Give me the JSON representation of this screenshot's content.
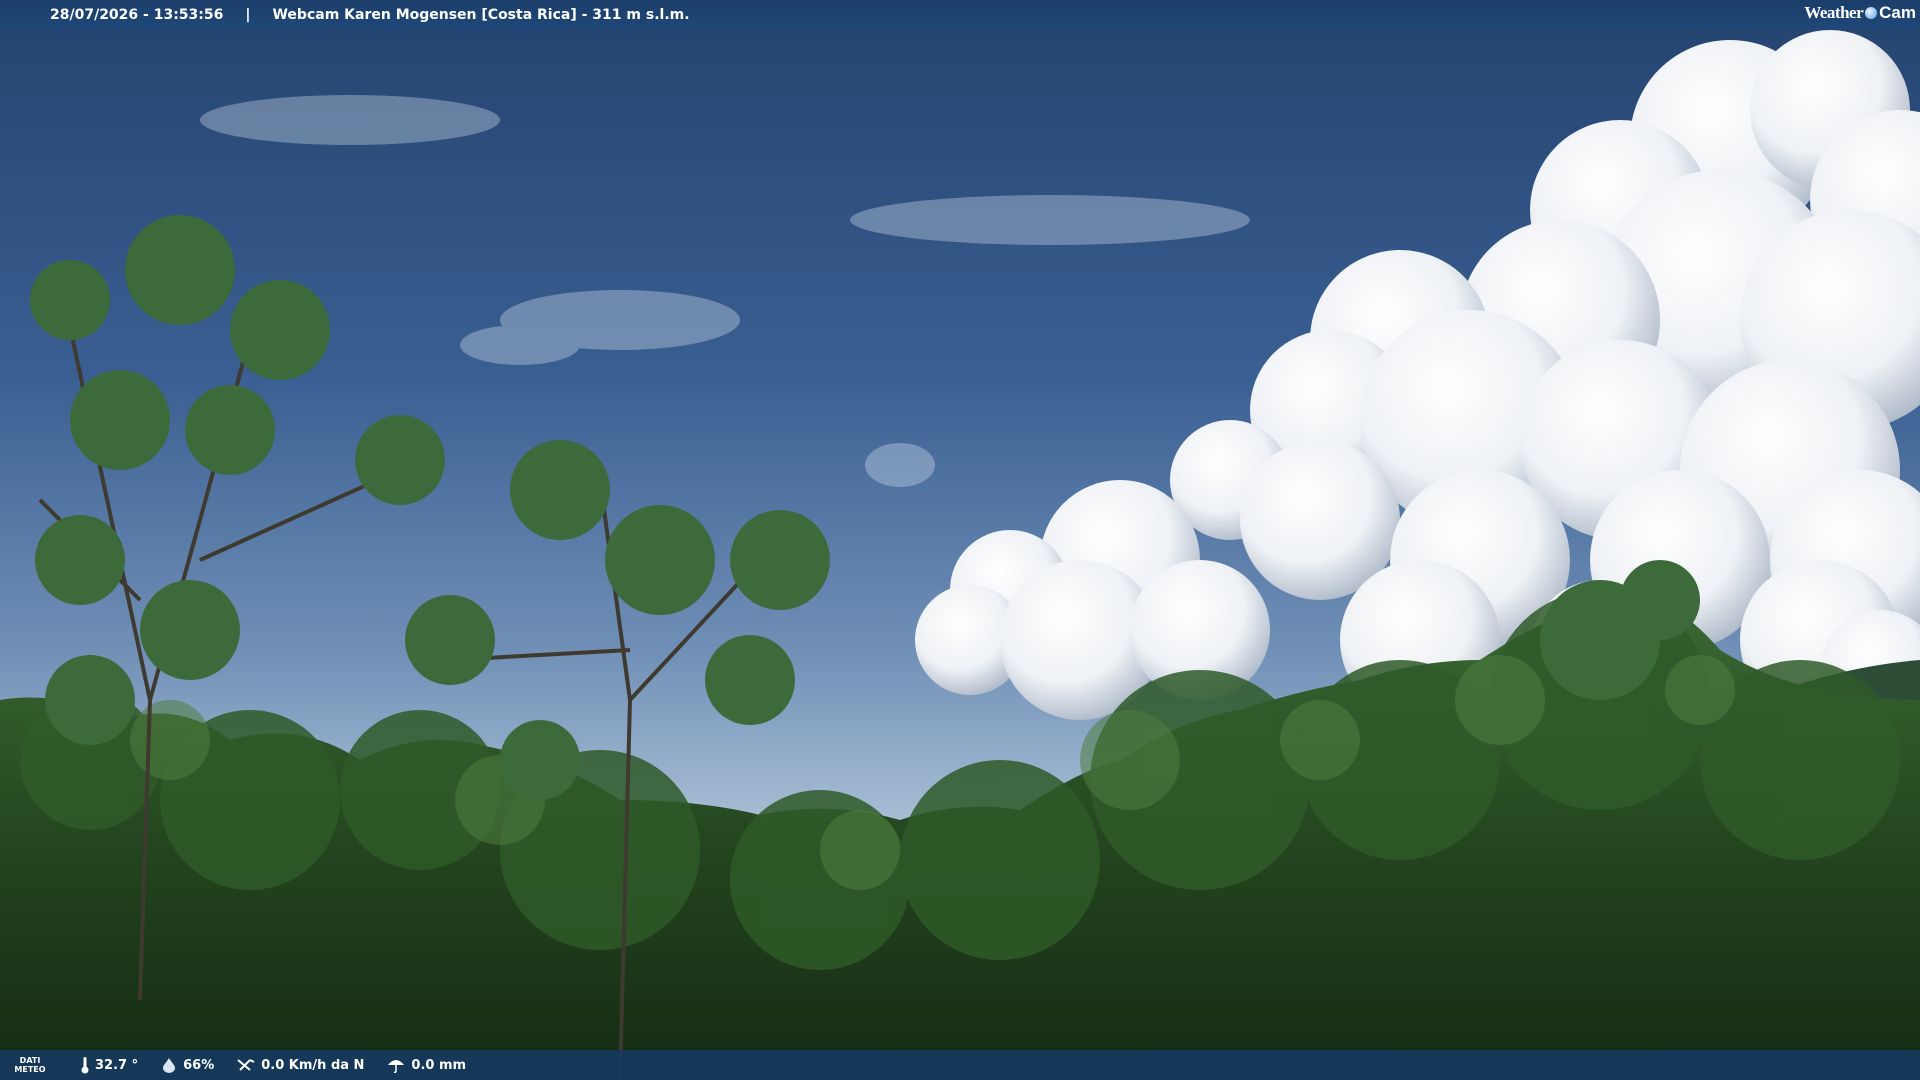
{
  "header": {
    "datetime": "28/07/2026 - 13:53:56",
    "separator": "|",
    "title": "Webcam Karen Mogensen [Costa Rica]  - 311 m s.l.m.",
    "brand_left": "Weather",
    "brand_right": "Cam"
  },
  "footer": {
    "dati_line1": "DATI",
    "dati_line2": "METEO",
    "temperature": "32.7 °",
    "humidity": "66%",
    "wind": "0.0 Km/h da N",
    "rain": "0.0 mm"
  },
  "colors": {
    "bar": "#1f4778",
    "sky_top": "#27497a",
    "sky_horizon": "#b8cde0",
    "foliage": "#2a5224"
  },
  "icons": [
    "thermometer-icon",
    "humidity-icon",
    "wind-icon",
    "rain-icon"
  ]
}
